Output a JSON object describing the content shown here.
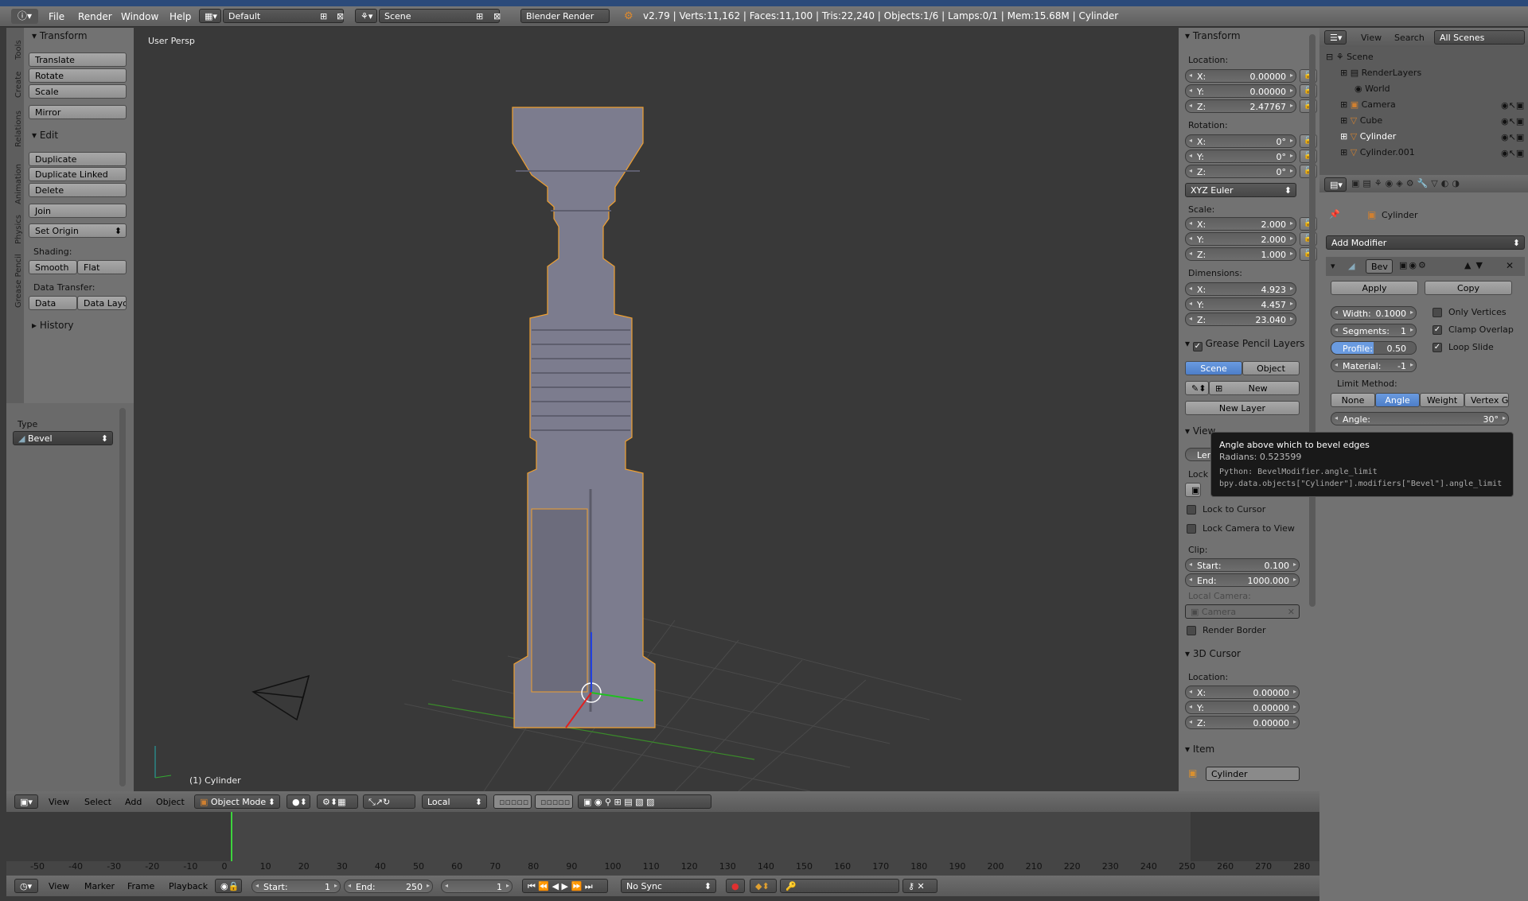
{
  "topbar": {
    "menus": [
      "File",
      "Render",
      "Window",
      "Help"
    ],
    "layout": "Default",
    "scene": "Scene",
    "engine": "Blender Render",
    "stats": "v2.79 | Verts:11,162 | Faces:11,100 | Tris:22,240 | Objects:1/6 | Lamps:0/1 | Mem:15.68M | Cylinder"
  },
  "tabs": [
    "Tools",
    "Create",
    "Relations",
    "Animation",
    "Physics",
    "Grease Pencil"
  ],
  "tools": {
    "transform_title": "Transform",
    "translate": "Translate",
    "rotate": "Rotate",
    "scale": "Scale",
    "mirror": "Mirror",
    "edit_title": "Edit",
    "duplicate": "Duplicate",
    "duplicate_linked": "Duplicate Linked",
    "delete": "Delete",
    "join": "Join",
    "set_origin": "Set Origin",
    "shading": "Shading:",
    "smooth": "Smooth",
    "flat": "Flat",
    "data_transfer": "Data Transfer:",
    "data": "Data",
    "data_layo": "Data Layo",
    "history": "History",
    "type_label": "Type",
    "type_value": "Bevel"
  },
  "viewport": {
    "persp": "User Persp",
    "object": "(1) Cylinder"
  },
  "npanel": {
    "transform": "Transform",
    "location": "Location:",
    "loc": [
      {
        "k": "X:",
        "v": "0.00000"
      },
      {
        "k": "Y:",
        "v": "0.00000"
      },
      {
        "k": "Z:",
        "v": "2.47767"
      }
    ],
    "rotation": "Rotation:",
    "rot": [
      {
        "k": "X:",
        "v": "0°"
      },
      {
        "k": "Y:",
        "v": "0°"
      },
      {
        "k": "Z:",
        "v": "0°"
      }
    ],
    "euler": "XYZ Euler",
    "scale": "Scale:",
    "scl": [
      {
        "k": "X:",
        "v": "2.000"
      },
      {
        "k": "Y:",
        "v": "2.000"
      },
      {
        "k": "Z:",
        "v": "1.000"
      }
    ],
    "dimensions": "Dimensions:",
    "dim": [
      {
        "k": "X:",
        "v": "4.923"
      },
      {
        "k": "Y:",
        "v": "4.457"
      },
      {
        "k": "Z:",
        "v": "23.040"
      }
    ],
    "gp_layers": "Grease Pencil Layers",
    "scene_btn": "Scene",
    "object_btn": "Object",
    "new": "New",
    "new_layer": "New Layer",
    "view": "View",
    "len": "Len",
    "lock": "Lock",
    "lock_cursor": "Lock to Cursor",
    "lock_camera": "Lock Camera to View",
    "clip": "Clip:",
    "clip_start": {
      "k": "Start:",
      "v": "0.100"
    },
    "clip_end": {
      "k": "End:",
      "v": "1000.000"
    },
    "local_camera": "Local Camera:",
    "camera": "Camera",
    "render_border": "Render Border",
    "cursor": "3D Cursor",
    "cursor_loc": "Location:",
    "cur": [
      {
        "k": "X:",
        "v": "0.00000"
      },
      {
        "k": "Y:",
        "v": "0.00000"
      },
      {
        "k": "Z:",
        "v": "0.00000"
      }
    ],
    "item": "Item",
    "item_name": "Cylinder"
  },
  "outliner": {
    "view": "View",
    "search": "Search",
    "scenes": "All Scenes",
    "items": [
      "Scene",
      "RenderLayers",
      "World",
      "Camera",
      "Cube",
      "Cylinder",
      "Cylinder.001"
    ]
  },
  "props": {
    "object": "Cylinder",
    "add_modifier": "Add Modifier",
    "mod_name": "Bev",
    "apply": "Apply",
    "copy": "Copy",
    "width": {
      "k": "Width:",
      "v": "0.1000"
    },
    "segments": {
      "k": "Segments:",
      "v": "1"
    },
    "profile": {
      "k": "Profile:",
      "v": "0.50"
    },
    "material": {
      "k": "Material:",
      "v": "-1"
    },
    "only_vertices": "Only Vertices",
    "clamp_overlap": "Clamp Overlap",
    "loop_slide": "Loop Slide",
    "limit_method": "Limit Method:",
    "lm": [
      "None",
      "Angle",
      "Weight",
      "Vertex G..."
    ],
    "angle": {
      "k": "Angle:",
      "v": "30°"
    }
  },
  "tooltip": {
    "title": "Angle above which to bevel edges",
    "radians": "Radians: 0.523599",
    "python1": "Python: BevelModifier.angle_limit",
    "python2": "bpy.data.objects[\"Cylinder\"].modifiers[\"Bevel\"].angle_limit"
  },
  "vpheader": {
    "view": "View",
    "select": "Select",
    "add": "Add",
    "object": "Object",
    "mode": "Object Mode",
    "pivot": "Local"
  },
  "timeline": {
    "ticks": [
      "-50",
      "-40",
      "-30",
      "-20",
      "-10",
      "0",
      "10",
      "20",
      "30",
      "40",
      "50",
      "60",
      "70",
      "80",
      "90",
      "100",
      "110",
      "120",
      "130",
      "140",
      "150",
      "160",
      "170",
      "180",
      "190",
      "200",
      "210",
      "220",
      "230",
      "240",
      "250",
      "260",
      "270",
      "280"
    ],
    "view": "View",
    "marker": "Marker",
    "frame": "Frame",
    "playback": "Playback",
    "start": {
      "k": "Start:",
      "v": "1"
    },
    "end": {
      "k": "End:",
      "v": "250"
    },
    "current": "1",
    "sync": "No Sync"
  }
}
